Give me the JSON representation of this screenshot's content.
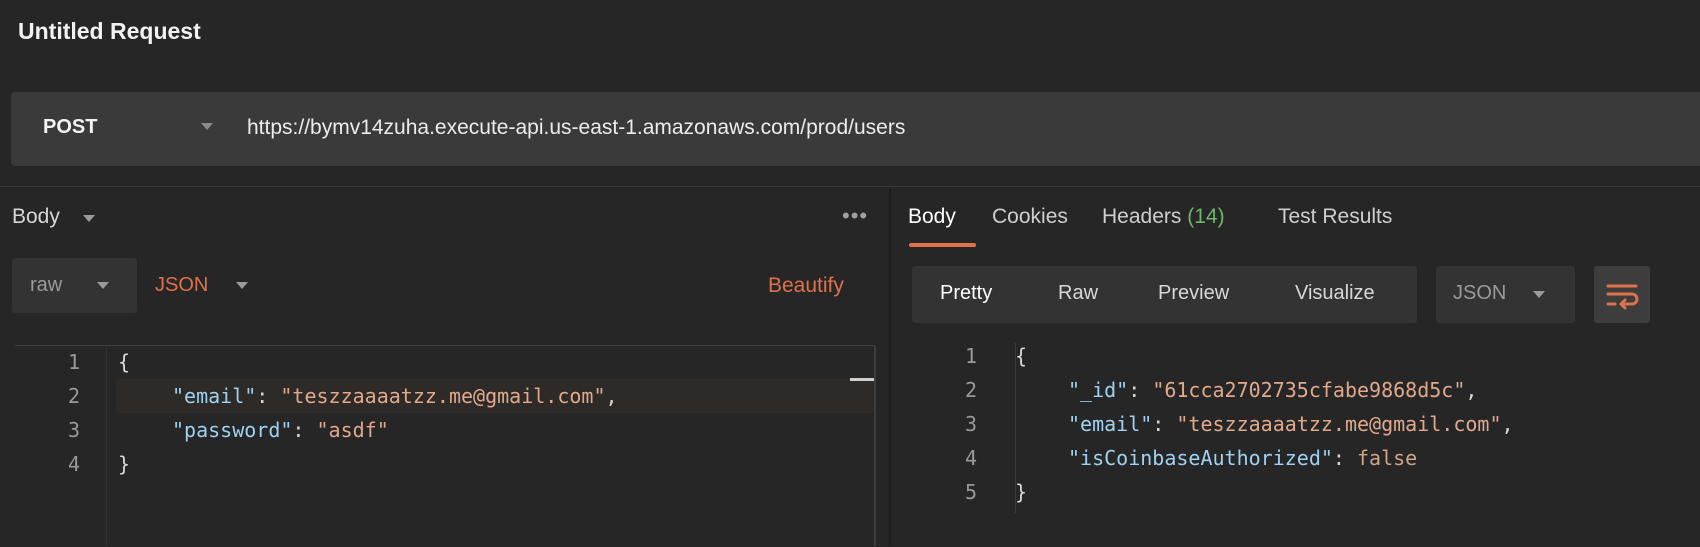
{
  "title": "Untitled Request",
  "request": {
    "method": "POST",
    "url": "https://bymv14zuha.execute-api.us-east-1.amazonaws.com/prod/users"
  },
  "request_body": {
    "section_label": "Body",
    "mode": "raw",
    "format": "JSON",
    "beautify_label": "Beautify",
    "line_numbers": [
      "1",
      "2",
      "3",
      "4"
    ],
    "lines": {
      "l1_open": "{",
      "l2_key": "\"email\"",
      "l2_sep": ": ",
      "l2_val": "\"teszzaaaatzz.me@gmail.com\"",
      "l2_end": ",",
      "l3_key": "\"password\"",
      "l3_sep": ": ",
      "l3_val": "\"asdf\"",
      "l4_close": "}"
    }
  },
  "response": {
    "tabs": {
      "body": "Body",
      "cookies": "Cookies",
      "headers": "Headers",
      "headers_count": "(14)",
      "test_results": "Test Results"
    },
    "view_buttons": {
      "pretty": "Pretty",
      "raw": "Raw",
      "preview": "Preview",
      "visualize": "Visualize"
    },
    "format": "JSON",
    "wrap_icon": "wrap-lines-icon",
    "line_numbers": [
      "1",
      "2",
      "3",
      "4",
      "5"
    ],
    "lines": {
      "l1_open": "{",
      "l2_key": "\"_id\"",
      "l2_sep": ": ",
      "l2_val": "\"61cca2702735cfabe9868d5c\"",
      "l2_end": ",",
      "l3_key": "\"email\"",
      "l3_sep": ": ",
      "l3_val": "\"teszzaaaatzz.me@gmail.com\"",
      "l3_end": ",",
      "l4_key": "\"isCoinbaseAuthorized\"",
      "l4_sep": ": ",
      "l4_val": "false",
      "l5_close": "}"
    }
  },
  "colors": {
    "accent": "#e0714b",
    "json_key": "#9fd2f2",
    "json_string": "#e1a98c",
    "count_green": "#6fb56a",
    "background": "#262626"
  }
}
